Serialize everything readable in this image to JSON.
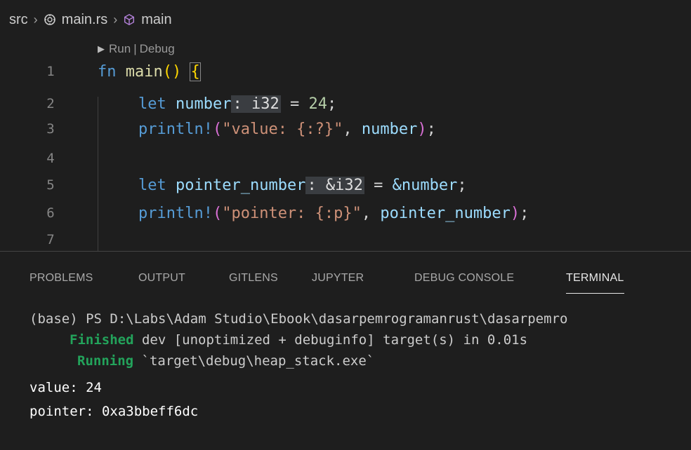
{
  "breadcrumb": {
    "folder": "src",
    "file": "main.rs",
    "symbol": "main",
    "separator": "›"
  },
  "codelens": {
    "run": "Run",
    "separator": "|",
    "debug": "Debug"
  },
  "lines": [
    {
      "n": "1"
    },
    {
      "n": "2"
    },
    {
      "n": "3"
    },
    {
      "n": "4"
    },
    {
      "n": "5"
    },
    {
      "n": "6"
    },
    {
      "n": "7"
    }
  ],
  "code": {
    "l1": {
      "kw": "fn",
      "name": "main",
      "parens": "()",
      "brace": "{"
    },
    "l2": {
      "kw": "let",
      "var": "number",
      "hint": ": i32",
      "eq": " = ",
      "val": "24",
      "semi": ";"
    },
    "l3": {
      "macro": "println!",
      "open": "(",
      "str": "\"value: {:?}\"",
      "comma": ", ",
      "arg": "number",
      "close": ")",
      "semi": ";"
    },
    "l5": {
      "kw": "let",
      "var": "pointer_number",
      "hint": ": &i32",
      "eq": " = ",
      "val": "&number",
      "semi": ";"
    },
    "l6": {
      "macro": "println!",
      "open": "(",
      "str": "\"pointer: {:p}\"",
      "comma": ", ",
      "arg": "pointer_number",
      "close": ")",
      "semi": ";"
    }
  },
  "panel": {
    "tabs": [
      "PROBLEMS",
      "OUTPUT",
      "GITLENS",
      "JUPYTER",
      "DEBUG CONSOLE",
      "TERMINAL"
    ],
    "active_tab": "TERMINAL"
  },
  "terminal": {
    "prompt": "(base) PS D:\\Labs\\Adam Studio\\Ebook\\dasarpemrogramanrust\\dasarpemro",
    "finished_label": "Finished",
    "finished_text": " dev [unoptimized + debuginfo] target(s) in 0.01s",
    "running_label": "Running",
    "running_text": " `target\\debug\\heap_stack.exe`",
    "output1": "value: 24",
    "output2": "pointer: 0xa3bbeff6dc"
  },
  "colors": {
    "background": "#1e1e1e",
    "keyword": "#569cd6",
    "function": "#dcdcaa",
    "variable": "#9cdcfe",
    "number": "#b5cea8",
    "string": "#ce9178",
    "cargo_green": "#23a35b"
  },
  "icons": {
    "file_icon": "rust-file-icon",
    "symbol_icon": "cube-symbol-icon",
    "codelens_icon": "play-triangle-icon"
  }
}
